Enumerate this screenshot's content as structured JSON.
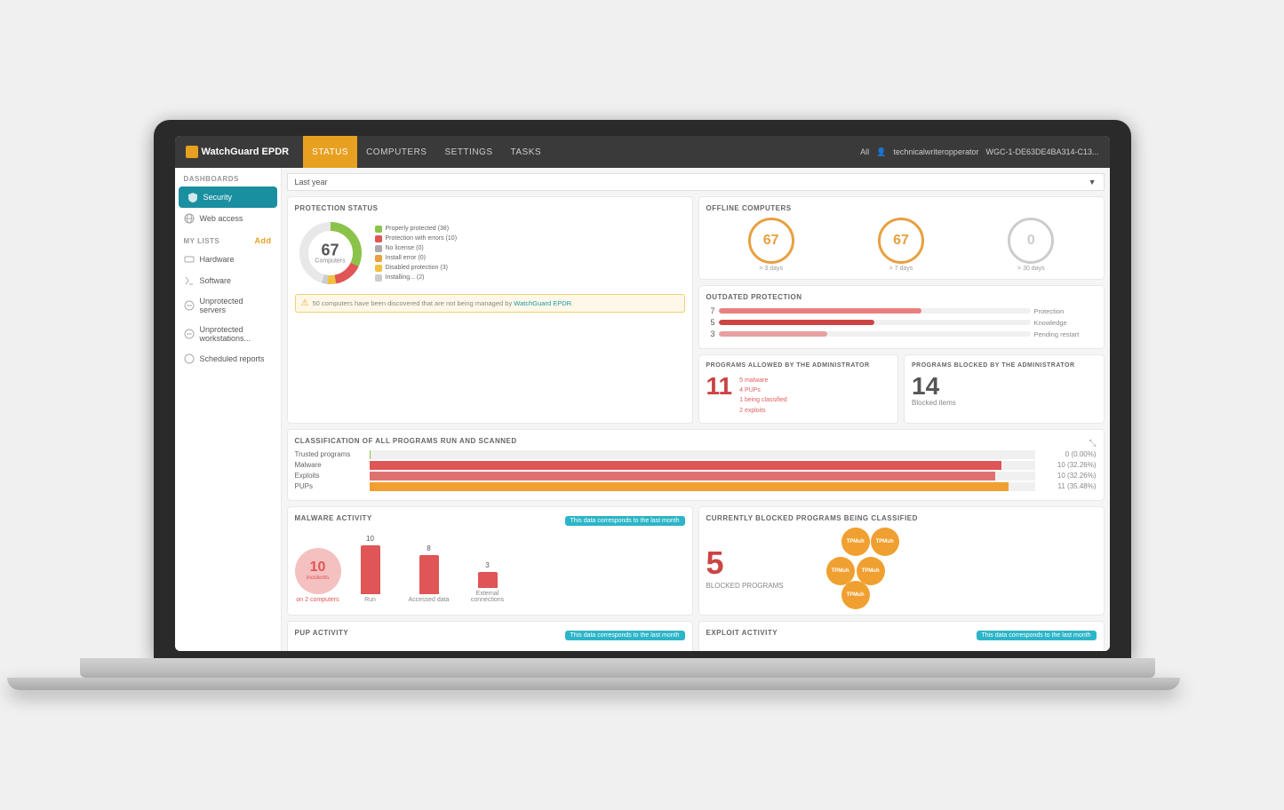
{
  "app": {
    "logo": "WatchGuard EPDR",
    "nav": [
      "STATUS",
      "COMPUTERS",
      "SETTINGS",
      "TASKS"
    ],
    "active_nav": "STATUS",
    "header_right": {
      "all_label": "All",
      "user": "technicalwriteropperator",
      "machine": "WGC-1-DE63DE4BA314-C13..."
    }
  },
  "sidebar": {
    "dashboards_label": "DASHBOARDS",
    "add_label": "Add",
    "dashboard_items": [
      {
        "label": "Security",
        "active": true
      },
      {
        "label": "Web access",
        "active": false
      }
    ],
    "my_lists_label": "MY LISTS",
    "list_items": [
      {
        "label": "Hardware"
      },
      {
        "label": "Software"
      },
      {
        "label": "Unprotected servers"
      },
      {
        "label": "Unprotected workstations..."
      },
      {
        "label": "Scheduled reports"
      }
    ]
  },
  "filter_bar": {
    "label": "Last year"
  },
  "protection_status": {
    "title": "PROTECTION STATUS",
    "total": "67",
    "computers_label": "Computers",
    "legend": [
      {
        "label": "Properly protected (38)",
        "color": "#8bc34a"
      },
      {
        "label": "Protection with errors (10)",
        "color": "#e05555"
      },
      {
        "label": "No license (0)",
        "color": "#aaaaaa"
      },
      {
        "label": "Install error (0)",
        "color": "#e8a040"
      },
      {
        "label": "Disabled protection (3)",
        "color": "#f0c040"
      },
      {
        "label": "Installing... (2)",
        "color": "#cccccc"
      }
    ],
    "alert": "50 computers have been discovered that are not being managed by WatchGuard EPDR."
  },
  "offline_computers": {
    "title": "OFFLINE COMPUTERS",
    "metrics": [
      {
        "value": "67",
        "label": "> 3 days",
        "color": "orange"
      },
      {
        "value": "67",
        "label": "> 7 days",
        "color": "orange"
      },
      {
        "value": "0",
        "label": "> 30 days",
        "color": "gray"
      }
    ]
  },
  "outdated_protection": {
    "title": "OUTDATED PROTECTION",
    "rows": [
      {
        "num": "7",
        "label": "Protection",
        "width": "65%"
      },
      {
        "num": "5",
        "label": "Knowledge",
        "width": "50%"
      },
      {
        "num": "3",
        "label": "Pending restart",
        "width": "35%"
      }
    ]
  },
  "programs_allowed": {
    "title": "PROGRAMS ALLOWED BY THE ADMINISTRATOR",
    "count": "11",
    "details": [
      "5 malware",
      "4 PUPs",
      "1 being classified",
      "2 exploits"
    ]
  },
  "programs_blocked": {
    "title": "PROGRAMS BLOCKED BY THE ADMINISTRATOR",
    "count": "14",
    "label": "Blocked items"
  },
  "classification": {
    "title": "CLASSIFICATION OF ALL PROGRAMS RUN AND SCANNED",
    "rows": [
      {
        "label": "Trusted programs",
        "count": "0",
        "percent": "(0.00%)",
        "bar_class": "trusted"
      },
      {
        "label": "Malware",
        "count": "10",
        "percent": "(32.26%)",
        "bar_class": "malware"
      },
      {
        "label": "Exploits",
        "count": "10",
        "percent": "(32.26%)",
        "bar_class": "exploits"
      },
      {
        "label": "PUPs",
        "count": "11",
        "percent": "(35.48%)",
        "bar_class": "pups"
      }
    ]
  },
  "malware_activity": {
    "title": "MALWARE ACTIVITY",
    "badge": "This data corresponds to the last month",
    "incidents": "10",
    "incidents_label": "incidents",
    "computers": "on 2 computers",
    "bars": [
      {
        "label": "Run",
        "value": "10",
        "height": 55
      },
      {
        "label": "Accessed data",
        "value": "8",
        "height": 45
      },
      {
        "label": "External connections",
        "value": "3",
        "height": 18
      }
    ]
  },
  "blocked_programs": {
    "title": "CURRENTLY BLOCKED PROGRAMS BEING CLASSIFIED",
    "count": "5",
    "label": "BLOCKED PROGRAMS",
    "bubbles": [
      "TPMuh",
      "TPMuh",
      "TPMuh",
      "TPMuh",
      "TPMuh"
    ]
  },
  "pup_activity": {
    "title": "PUP ACTIVITY",
    "badge": "This data corresponds to the last month"
  },
  "exploit_activity": {
    "title": "EXPLOIT ACTIVITY",
    "badge": "This data corresponds to the last month"
  }
}
